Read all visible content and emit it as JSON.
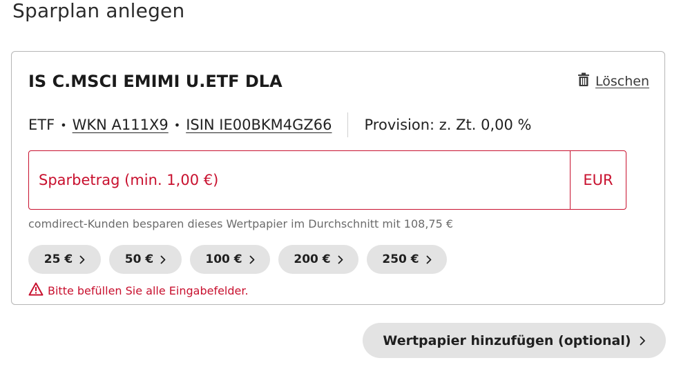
{
  "page": {
    "title": "Sparplan anlegen"
  },
  "security": {
    "name": "IS C.MSCI EMIMI U.ETF DLA",
    "delete_label": "Löschen",
    "type": "ETF",
    "separator": "•",
    "wkn": "WKN A111X9",
    "isin": "ISIN IE00BKM4GZ66",
    "commission": "Provision: z. Zt. 0,00 %"
  },
  "amount": {
    "placeholder": "Sparbetrag (min. 1,00 €)",
    "value": "",
    "currency": "EUR",
    "hint": "comdirect-Kunden besparen dieses Wertpapier im Durchschnitt mit 108,75 €"
  },
  "quick_amounts": [
    {
      "label": "25 €"
    },
    {
      "label": "50 €"
    },
    {
      "label": "100 €"
    },
    {
      "label": "200 €"
    },
    {
      "label": "250 €"
    }
  ],
  "validation": {
    "error": "Bitte befüllen Sie alle Eingabefelder."
  },
  "actions": {
    "add_security": "Wertpapier hinzufügen (optional)"
  },
  "icons": {
    "delete": "trash-icon",
    "chip_arrow": "chevron-right-icon",
    "error": "warning-triangle-icon",
    "add_arrow": "chevron-right-icon"
  },
  "colors": {
    "error": "#c8102e",
    "chip_bg": "#e3e3e3",
    "border": "#b5b5b5",
    "hint": "#6b6b6b"
  }
}
